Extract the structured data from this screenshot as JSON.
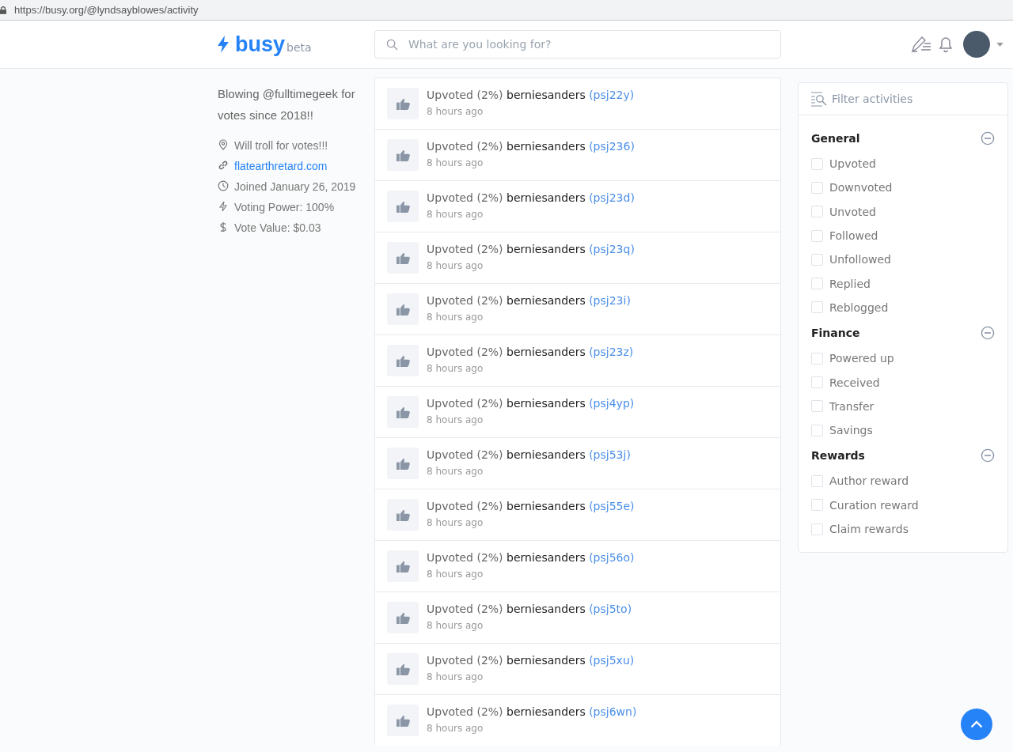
{
  "browser": {
    "url": "https://busy.org/@lyndsayblowes/activity"
  },
  "header": {
    "logo": "busy",
    "logo_badge": "beta",
    "search": {
      "placeholder": "What are you looking for?"
    }
  },
  "profile": {
    "bio": "Blowing @fulltimegeek for votes since 2018!!",
    "details": [
      {
        "kind": "location",
        "text": "Will troll for votes!!!"
      },
      {
        "kind": "link",
        "text": "flatearthretard.com"
      },
      {
        "kind": "joined",
        "text": "Joined January 26, 2019"
      },
      {
        "kind": "power",
        "text": "Voting Power: 100%"
      },
      {
        "kind": "value",
        "text": "Vote Value: $0.03"
      }
    ]
  },
  "activities": [
    {
      "action": "Upvoted (2%)",
      "author": "berniesanders",
      "post": "(psj22y)",
      "time": "8 hours ago"
    },
    {
      "action": "Upvoted (2%)",
      "author": "berniesanders",
      "post": "(psj236)",
      "time": "8 hours ago"
    },
    {
      "action": "Upvoted (2%)",
      "author": "berniesanders",
      "post": "(psj23d)",
      "time": "8 hours ago"
    },
    {
      "action": "Upvoted (2%)",
      "author": "berniesanders",
      "post": "(psj23q)",
      "time": "8 hours ago"
    },
    {
      "action": "Upvoted (2%)",
      "author": "berniesanders",
      "post": "(psj23i)",
      "time": "8 hours ago"
    },
    {
      "action": "Upvoted (2%)",
      "author": "berniesanders",
      "post": "(psj23z)",
      "time": "8 hours ago"
    },
    {
      "action": "Upvoted (2%)",
      "author": "berniesanders",
      "post": "(psj4yp)",
      "time": "8 hours ago"
    },
    {
      "action": "Upvoted (2%)",
      "author": "berniesanders",
      "post": "(psj53j)",
      "time": "8 hours ago"
    },
    {
      "action": "Upvoted (2%)",
      "author": "berniesanders",
      "post": "(psj55e)",
      "time": "8 hours ago"
    },
    {
      "action": "Upvoted (2%)",
      "author": "berniesanders",
      "post": "(psj56o)",
      "time": "8 hours ago"
    },
    {
      "action": "Upvoted (2%)",
      "author": "berniesanders",
      "post": "(psj5to)",
      "time": "8 hours ago"
    },
    {
      "action": "Upvoted (2%)",
      "author": "berniesanders",
      "post": "(psj5xu)",
      "time": "8 hours ago"
    },
    {
      "action": "Upvoted (2%)",
      "author": "berniesanders",
      "post": "(psj6wn)",
      "time": "8 hours ago"
    }
  ],
  "filter": {
    "title": "Filter activities",
    "groups": [
      {
        "title": "General",
        "expanded": true,
        "options": [
          {
            "label": "Upvoted",
            "checked": false
          },
          {
            "label": "Downvoted",
            "checked": false
          },
          {
            "label": "Unvoted",
            "checked": false
          },
          {
            "label": "Followed",
            "checked": false
          },
          {
            "label": "Unfollowed",
            "checked": false
          },
          {
            "label": "Replied",
            "checked": false
          },
          {
            "label": "Reblogged",
            "checked": false
          }
        ]
      },
      {
        "title": "Finance",
        "expanded": true,
        "options": [
          {
            "label": "Powered up",
            "checked": false
          },
          {
            "label": "Received",
            "checked": false
          },
          {
            "label": "Transfer",
            "checked": false
          },
          {
            "label": "Savings",
            "checked": false
          }
        ]
      },
      {
        "title": "Rewards",
        "expanded": true,
        "options": [
          {
            "label": "Author reward",
            "checked": false
          },
          {
            "label": "Curation reward",
            "checked": false
          },
          {
            "label": "Claim rewards",
            "checked": false
          }
        ]
      }
    ]
  }
}
